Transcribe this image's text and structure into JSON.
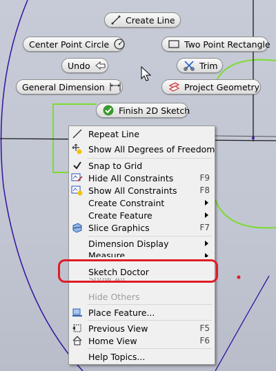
{
  "marking_menu": {
    "create_line": "Create Line",
    "center_point_circle": "Center Point Circle",
    "two_point_rectangle": "Two Point Rectangle",
    "undo": "Undo",
    "trim": "Trim",
    "general_dimension": "General Dimension",
    "project_geometry": "Project Geometry",
    "finish_2d_sketch": "Finish 2D Sketch"
  },
  "context_menu": {
    "items": [
      {
        "label": "Repeat Line",
        "icon": "line-icon",
        "shortcut": ""
      },
      {
        "label": "Show All Degrees of Freedom",
        "icon": "dof-icon",
        "shortcut": ""
      },
      {
        "label": "Snap to Grid",
        "icon": "checkmark-icon",
        "shortcut": ""
      },
      {
        "label": "Hide All Constraints",
        "icon": "hide-constraints-icon",
        "shortcut": "F9"
      },
      {
        "label": "Show All Constraints",
        "icon": "show-constraints-icon",
        "shortcut": "F8"
      },
      {
        "label": "Create Constraint",
        "submenu": true
      },
      {
        "label": "Create Feature",
        "submenu": true
      },
      {
        "label": "Slice Graphics",
        "icon": "slice-graphics-icon",
        "shortcut": "F7"
      },
      {
        "label": "Dimension Display",
        "submenu": true
      },
      {
        "label": "Measure",
        "submenu": true
      },
      {
        "label": "Sketch Doctor"
      },
      {
        "label": "Show All",
        "disabled": true
      },
      {
        "label": "Hide Others",
        "disabled": true
      },
      {
        "label": "Place Feature...",
        "icon": "place-feature-icon"
      },
      {
        "label": "Previous View",
        "icon": "previous-view-icon",
        "shortcut": "F5"
      },
      {
        "label": "Home View",
        "icon": "home-view-icon",
        "shortcut": "F6"
      },
      {
        "label": "Help Topics..."
      }
    ]
  },
  "colors": {
    "background": "#c3c8d4",
    "sketch_green": "#7cdc2e",
    "construction_purple": "#3a1aa0",
    "annotation_red": "#e01b24"
  }
}
